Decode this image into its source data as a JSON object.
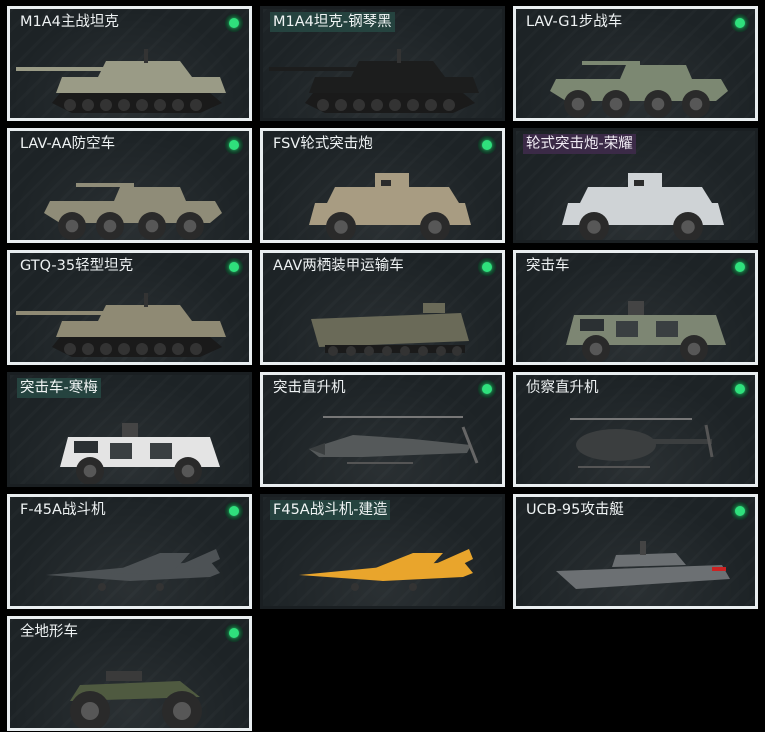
{
  "vehicles": [
    {
      "name": "M1A4主战坦克",
      "status_icon": "owned-check-icon",
      "owned": true,
      "kind": "tank",
      "color": "#9a9b86"
    },
    {
      "name": "M1A4坦克-钢琴黑",
      "status_icon": "",
      "owned": false,
      "kind": "tank",
      "color": "#1c1d1d"
    },
    {
      "name": "LAV-G1步战车",
      "status_icon": "owned-check-icon",
      "owned": true,
      "kind": "apc",
      "color": "#7c8872"
    },
    {
      "name": "LAV-AA防空车",
      "status_icon": "owned-check-icon",
      "owned": true,
      "kind": "apc",
      "color": "#8f8c78"
    },
    {
      "name": "FSV轮式突击炮",
      "status_icon": "owned-check-icon",
      "owned": true,
      "kind": "armored-car",
      "color": "#a89c82"
    },
    {
      "name": "轮式突击炮-荣耀",
      "status_icon": "",
      "owned": false,
      "kind": "armored-car",
      "color": "#cfd3d6"
    },
    {
      "name": "GTQ-35轻型坦克",
      "status_icon": "owned-check-icon",
      "owned": true,
      "kind": "tank",
      "color": "#8f8a74"
    },
    {
      "name": "AAV两栖装甲运输车",
      "status_icon": "owned-check-icon",
      "owned": true,
      "kind": "amphibious",
      "color": "#6a6a58"
    },
    {
      "name": "突击车",
      "status_icon": "owned-check-icon",
      "owned": true,
      "kind": "truck",
      "color": "#7d8673"
    },
    {
      "name": "突击车-寒梅",
      "status_icon": "",
      "owned": false,
      "kind": "truck",
      "color": "#e4e4e4"
    },
    {
      "name": "突击直升机",
      "status_icon": "owned-check-icon",
      "owned": true,
      "kind": "helicopter",
      "color": "#55595a"
    },
    {
      "name": "侦察直升机",
      "status_icon": "owned-check-icon",
      "owned": true,
      "kind": "small-helicopter",
      "color": "#3b3e3f"
    },
    {
      "name": "F-45A战斗机",
      "status_icon": "owned-check-icon",
      "owned": true,
      "kind": "jet",
      "color": "#4d5255"
    },
    {
      "name": "F45A战斗机-建造",
      "status_icon": "",
      "owned": false,
      "kind": "jet",
      "color": "#e9a52c"
    },
    {
      "name": "UCB-95攻击艇",
      "status_icon": "owned-check-icon",
      "owned": true,
      "kind": "boat",
      "color": "#6c7073"
    },
    {
      "name": "全地形车",
      "status_icon": "owned-check-icon",
      "owned": true,
      "kind": "atv",
      "color": "#4f5a40"
    }
  ],
  "colors": {
    "owned_indicator": "#2fe07c",
    "owned_border": "#e9eef0",
    "card_background": "#1d2326",
    "skin_tag_background": "#25433f"
  }
}
